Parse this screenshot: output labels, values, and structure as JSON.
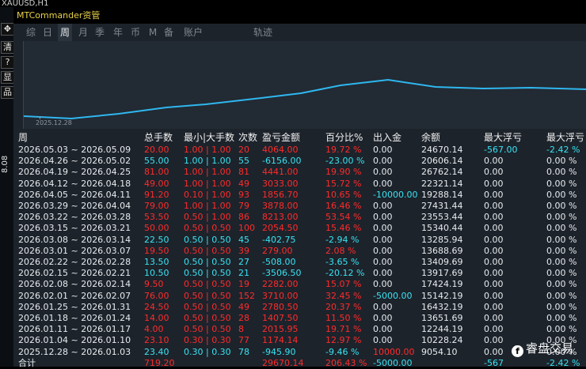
{
  "chart_title": "XAUUSD,H1",
  "left_toolbar": {
    "buttons": [
      "✥",
      "清",
      "?",
      "显",
      "品"
    ],
    "price": "8.08"
  },
  "window_title": "MTCommander资管",
  "tabs": [
    "综",
    "日",
    "周",
    "月",
    "季",
    "年",
    "币",
    "M",
    "备",
    "账户",
    "轨迹"
  ],
  "active_tab": "周",
  "chart": {
    "date_label": "2025.12.28",
    "line_color": "#2fb7ef"
  },
  "table": {
    "headers": [
      "周",
      "总手数",
      "最小|大手数",
      "次数",
      "盈亏金额",
      "百分比%",
      "出入金",
      "余额",
      "最大浮亏",
      "最大浮亏"
    ],
    "rows": [
      {
        "date": "2026.05.03 ~ 2026.05.09",
        "lots": "20.00",
        "minmax": "1.00 | 1.00",
        "count": "20",
        "pnl": "4064.00",
        "pct": "19.72 %",
        "inout": "0.00",
        "balance": "24670.14",
        "maxloss": "-567.00",
        "maxloss_pct": "-2.42 %",
        "color": "red"
      },
      {
        "date": "2026.04.26 ~ 2026.05.02",
        "lots": "55.00",
        "minmax": "1.00 | 1.00",
        "count": "55",
        "pnl": "-6156.00",
        "pct": "-23.00 %",
        "inout": "0.00",
        "balance": "20606.14",
        "maxloss": "0.00",
        "maxloss_pct": "0.00 %",
        "color": "cyan"
      },
      {
        "date": "2026.04.19 ~ 2026.04.25",
        "lots": "81.00",
        "minmax": "1.00 | 1.00",
        "count": "81",
        "pnl": "4441.00",
        "pct": "19.90 %",
        "inout": "0.00",
        "balance": "26762.14",
        "maxloss": "0.00",
        "maxloss_pct": "0.00 %",
        "color": "red"
      },
      {
        "date": "2026.04.12 ~ 2026.04.18",
        "lots": "49.00",
        "minmax": "1.00 | 1.00",
        "count": "49",
        "pnl": "3033.00",
        "pct": "15.72 %",
        "inout": "0.00",
        "balance": "22321.14",
        "maxloss": "0.00",
        "maxloss_pct": "0.00 %",
        "color": "red"
      },
      {
        "date": "2026.04.05 ~ 2026.04.11",
        "lots": "91.20",
        "minmax": "0.10 | 1.00",
        "count": "93",
        "pnl": "1856.70",
        "pct": "10.65 %",
        "inout": "-10000.00",
        "balance": "19288.14",
        "maxloss": "0.00",
        "maxloss_pct": "0.00 %",
        "color": "red"
      },
      {
        "date": "2026.03.29 ~ 2026.04.04",
        "lots": "79.00",
        "minmax": "1.00 | 1.00",
        "count": "79",
        "pnl": "3878.00",
        "pct": "16.46 %",
        "inout": "0.00",
        "balance": "27431.44",
        "maxloss": "0.00",
        "maxloss_pct": "0.00 %",
        "color": "red"
      },
      {
        "date": "2026.03.22 ~ 2026.03.28",
        "lots": "53.50",
        "minmax": "0.50 | 1.00",
        "count": "86",
        "pnl": "8213.00",
        "pct": "53.54 %",
        "inout": "0.00",
        "balance": "23553.44",
        "maxloss": "0.00",
        "maxloss_pct": "0.00 %",
        "color": "red"
      },
      {
        "date": "2026.03.15 ~ 2026.03.21",
        "lots": "50.00",
        "minmax": "0.50 | 0.50",
        "count": "100",
        "pnl": "2054.50",
        "pct": "15.46 %",
        "inout": "0.00",
        "balance": "15340.44",
        "maxloss": "0.00",
        "maxloss_pct": "0.00 %",
        "color": "red"
      },
      {
        "date": "2026.03.08 ~ 2026.03.14",
        "lots": "22.50",
        "minmax": "0.50 | 0.50",
        "count": "45",
        "pnl": "-402.75",
        "pct": "-2.94 %",
        "inout": "0.00",
        "balance": "13285.94",
        "maxloss": "0.00",
        "maxloss_pct": "0.00 %",
        "color": "cyan"
      },
      {
        "date": "2026.03.01 ~ 2026.03.07",
        "lots": "19.50",
        "minmax": "0.50 | 0.50",
        "count": "39",
        "pnl": "279.00",
        "pct": "2.08 %",
        "inout": "0.00",
        "balance": "13688.69",
        "maxloss": "0.00",
        "maxloss_pct": "0.00 %",
        "color": "red"
      },
      {
        "date": "2026.02.22 ~ 2026.02.28",
        "lots": "13.50",
        "minmax": "0.50 | 0.50",
        "count": "27",
        "pnl": "-508.00",
        "pct": "-3.65 %",
        "inout": "0.00",
        "balance": "13409.69",
        "maxloss": "0.00",
        "maxloss_pct": "0.00 %",
        "color": "cyan"
      },
      {
        "date": "2026.02.15 ~ 2026.02.21",
        "lots": "10.50",
        "minmax": "0.50 | 0.50",
        "count": "21",
        "pnl": "-3506.50",
        "pct": "-20.12 %",
        "inout": "0.00",
        "balance": "13917.69",
        "maxloss": "0.00",
        "maxloss_pct": "0.00 %",
        "color": "cyan"
      },
      {
        "date": "2026.02.08 ~ 2026.02.14",
        "lots": "9.50",
        "minmax": "0.50 | 0.50",
        "count": "19",
        "pnl": "2282.00",
        "pct": "15.07 %",
        "inout": "0.00",
        "balance": "17424.19",
        "maxloss": "0.00",
        "maxloss_pct": "0.00 %",
        "color": "red"
      },
      {
        "date": "2026.02.01 ~ 2026.02.07",
        "lots": "76.00",
        "minmax": "0.50 | 0.50",
        "count": "152",
        "pnl": "3710.00",
        "pct": "32.45 %",
        "inout": "-5000.00",
        "balance": "15142.19",
        "maxloss": "0.00",
        "maxloss_pct": "0.00 %",
        "color": "red"
      },
      {
        "date": "2026.01.25 ~ 2026.01.31",
        "lots": "24.50",
        "minmax": "0.50 | 0.50",
        "count": "49",
        "pnl": "2780.50",
        "pct": "20.37 %",
        "inout": "0.00",
        "balance": "16432.19",
        "maxloss": "0.00",
        "maxloss_pct": "0.00 %",
        "color": "red"
      },
      {
        "date": "2026.01.18 ~ 2026.01.24",
        "lots": "14.00",
        "minmax": "0.50 | 0.50",
        "count": "28",
        "pnl": "1407.50",
        "pct": "11.50 %",
        "inout": "0.00",
        "balance": "13651.69",
        "maxloss": "0.00",
        "maxloss_pct": "0.00 %",
        "color": "red"
      },
      {
        "date": "2026.01.11 ~ 2026.01.17",
        "lots": "4.00",
        "minmax": "0.50 | 0.50",
        "count": "8",
        "pnl": "2015.95",
        "pct": "19.71 %",
        "inout": "0.00",
        "balance": "12244.19",
        "maxloss": "0.00",
        "maxloss_pct": "0.00 %",
        "color": "red"
      },
      {
        "date": "2026.01.04 ~ 2026.01.10",
        "lots": "23.10",
        "minmax": "0.30 | 0.30",
        "count": "77",
        "pnl": "1174.14",
        "pct": "12.97 %",
        "inout": "0.00",
        "balance": "10228.24",
        "maxloss": "0.00",
        "maxloss_pct": "0.00 %",
        "color": "red"
      },
      {
        "date": "2025.12.28 ~ 2026.01.03",
        "lots": "23.40",
        "minmax": "0.30 | 0.30",
        "count": "78",
        "pnl": "-945.90",
        "pct": "-9.46 %",
        "inout": "10000.00",
        "balance": "9054.10",
        "maxloss": "0.00",
        "maxloss_pct": "0.00 %",
        "color": "cyan"
      }
    ],
    "totals": {
      "date": "合计",
      "lots": "719.20",
      "pnl": "29670.14",
      "pct": "206.43 %",
      "inout": "-5000.00",
      "maxloss": "-567",
      "maxloss_pct": "-2.42 %"
    }
  },
  "watermark": "睿盘交易"
}
